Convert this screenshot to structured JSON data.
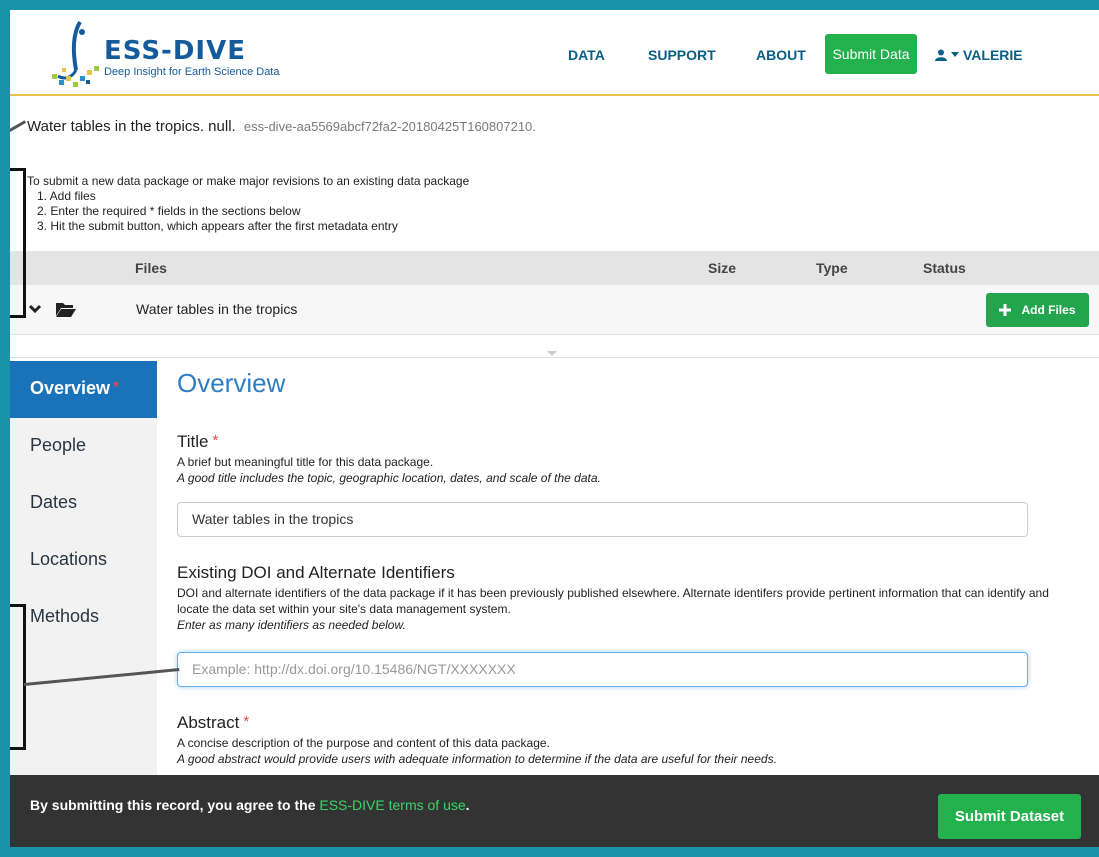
{
  "header": {
    "logo_title": "ESS-DIVE",
    "logo_tagline": "Deep Insight for Earth Science Data",
    "nav": [
      "DATA",
      "SUPPORT",
      "ABOUT"
    ],
    "submit_label": "Submit Data",
    "user_name": "VALERIE"
  },
  "package": {
    "title": "Water tables in the tropics. null.",
    "id": "ess-dive-aa5569abcf72fa2-20180425T160807210."
  },
  "instructions": {
    "intro": "To submit a new data package or make major revisions to an existing data package",
    "steps": [
      "1. Add files",
      "2. Enter the required * fields in the sections below",
      "3. Hit the submit button, which appears after the first metadata entry"
    ]
  },
  "files": {
    "columns": [
      "Files",
      "Size",
      "Type",
      "Status"
    ],
    "row_name": "Water tables in the tropics",
    "add_label": "Add Files"
  },
  "sidebar": {
    "items": [
      "Overview",
      "People",
      "Dates",
      "Locations",
      "Methods"
    ],
    "required_mark": "*"
  },
  "main": {
    "heading": "Overview",
    "title_field": {
      "label": "Title",
      "required": "*",
      "help1": "A brief but meaningful title for this data package.",
      "help2": "A good title includes the topic, geographic location, dates, and scale of the data.",
      "value": "Water tables in the tropics"
    },
    "doi_field": {
      "label": "Existing DOI and Alternate Identifiers",
      "help1": "DOI and alternate identifiers of the data package if it has been previously published elsewhere. Alternate identifers provide pertinent information that can identify and locate the data set within your site's data management system.",
      "help2": "Enter as many identifiers as needed below.",
      "placeholder": "Example: http://dx.doi.org/10.15486/NGT/XXXXXXX"
    },
    "abstract_field": {
      "label": "Abstract",
      "required": "*",
      "help1": "A concise description of the purpose and content of this data package.",
      "help2": "A good abstract would provide users with adequate information to determine if the data are useful for their needs."
    }
  },
  "footer": {
    "text": "By submitting this record, you agree to the",
    "link": "ESS-DIVE terms of use",
    "period": ".",
    "submit_label": "Submit Dataset"
  },
  "colors": {
    "frame": "#1893a8",
    "brand_blue": "#155b9c",
    "green": "#22b14c",
    "active_nav": "#1a72b8"
  }
}
